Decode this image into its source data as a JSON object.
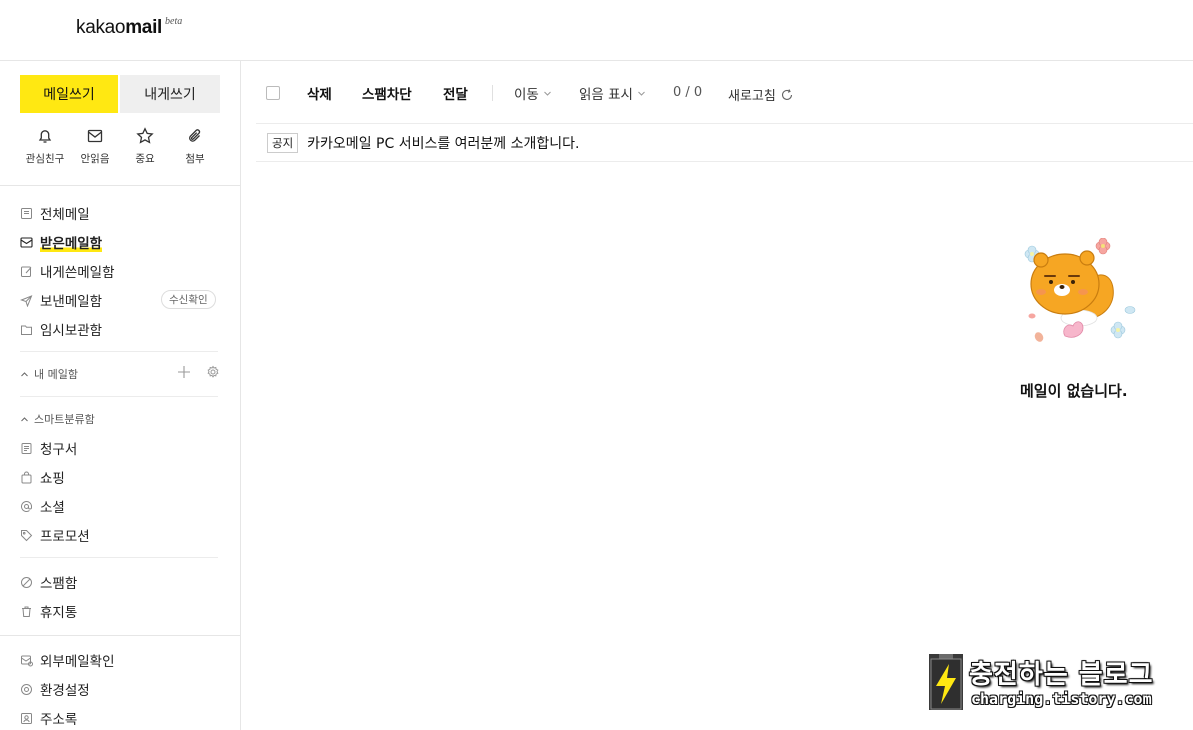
{
  "brand": {
    "logo_light": "kakao",
    "logo_bold": "mail",
    "logo_tag": "beta"
  },
  "sidebar": {
    "write_button": "메일쓰기",
    "self_button": "내게쓰기",
    "quick": [
      {
        "icon": "bell-icon",
        "label": "관심친구"
      },
      {
        "icon": "envelope-icon",
        "label": "안읽음"
      },
      {
        "icon": "star-icon",
        "label": "중요"
      },
      {
        "icon": "paperclip-icon",
        "label": "첨부"
      }
    ],
    "folders": [
      {
        "icon": "all-mail-icon",
        "label": "전체메일"
      },
      {
        "icon": "inbox-icon",
        "label": "받은메일함"
      },
      {
        "icon": "self-mail-icon",
        "label": "내게쓴메일함"
      },
      {
        "icon": "send-icon",
        "label": "보낸메일함",
        "badge": "수신확인"
      },
      {
        "icon": "folder-icon",
        "label": "임시보관함"
      }
    ],
    "my_mailbox_header": "내 메일함",
    "smart_header": "스마트분류함",
    "smart": [
      {
        "icon": "bill-icon",
        "label": "청구서"
      },
      {
        "icon": "shopping-bag-icon",
        "label": "쇼핑"
      },
      {
        "icon": "at-icon",
        "label": "소셜"
      },
      {
        "icon": "tag-icon",
        "label": "프로모션"
      }
    ],
    "trash_group": [
      {
        "icon": "spam-icon",
        "label": "스팸함"
      },
      {
        "icon": "trash-icon",
        "label": "휴지통"
      }
    ],
    "bottom": [
      {
        "icon": "external-mail-icon",
        "label": "외부메일확인"
      },
      {
        "icon": "settings-icon",
        "label": "환경설정"
      },
      {
        "icon": "contacts-icon",
        "label": "주소록"
      }
    ]
  },
  "toolbar": {
    "delete": "삭제",
    "spam_block": "스팸차단",
    "forward": "전달",
    "move": "이동",
    "read_mark": "읽음 표시",
    "count": "0 / 0",
    "refresh": "새로고침"
  },
  "notice": {
    "tag": "공지",
    "text": "카카오메일 PC 서비스를 여러분께 소개합니다."
  },
  "empty": {
    "message": "메일이 없습니다."
  },
  "watermark": {
    "title": "충전하는 블로그",
    "url": "charging.tistory.com"
  },
  "colors": {
    "accent": "#ffe812",
    "border": "#e6e6e6"
  }
}
